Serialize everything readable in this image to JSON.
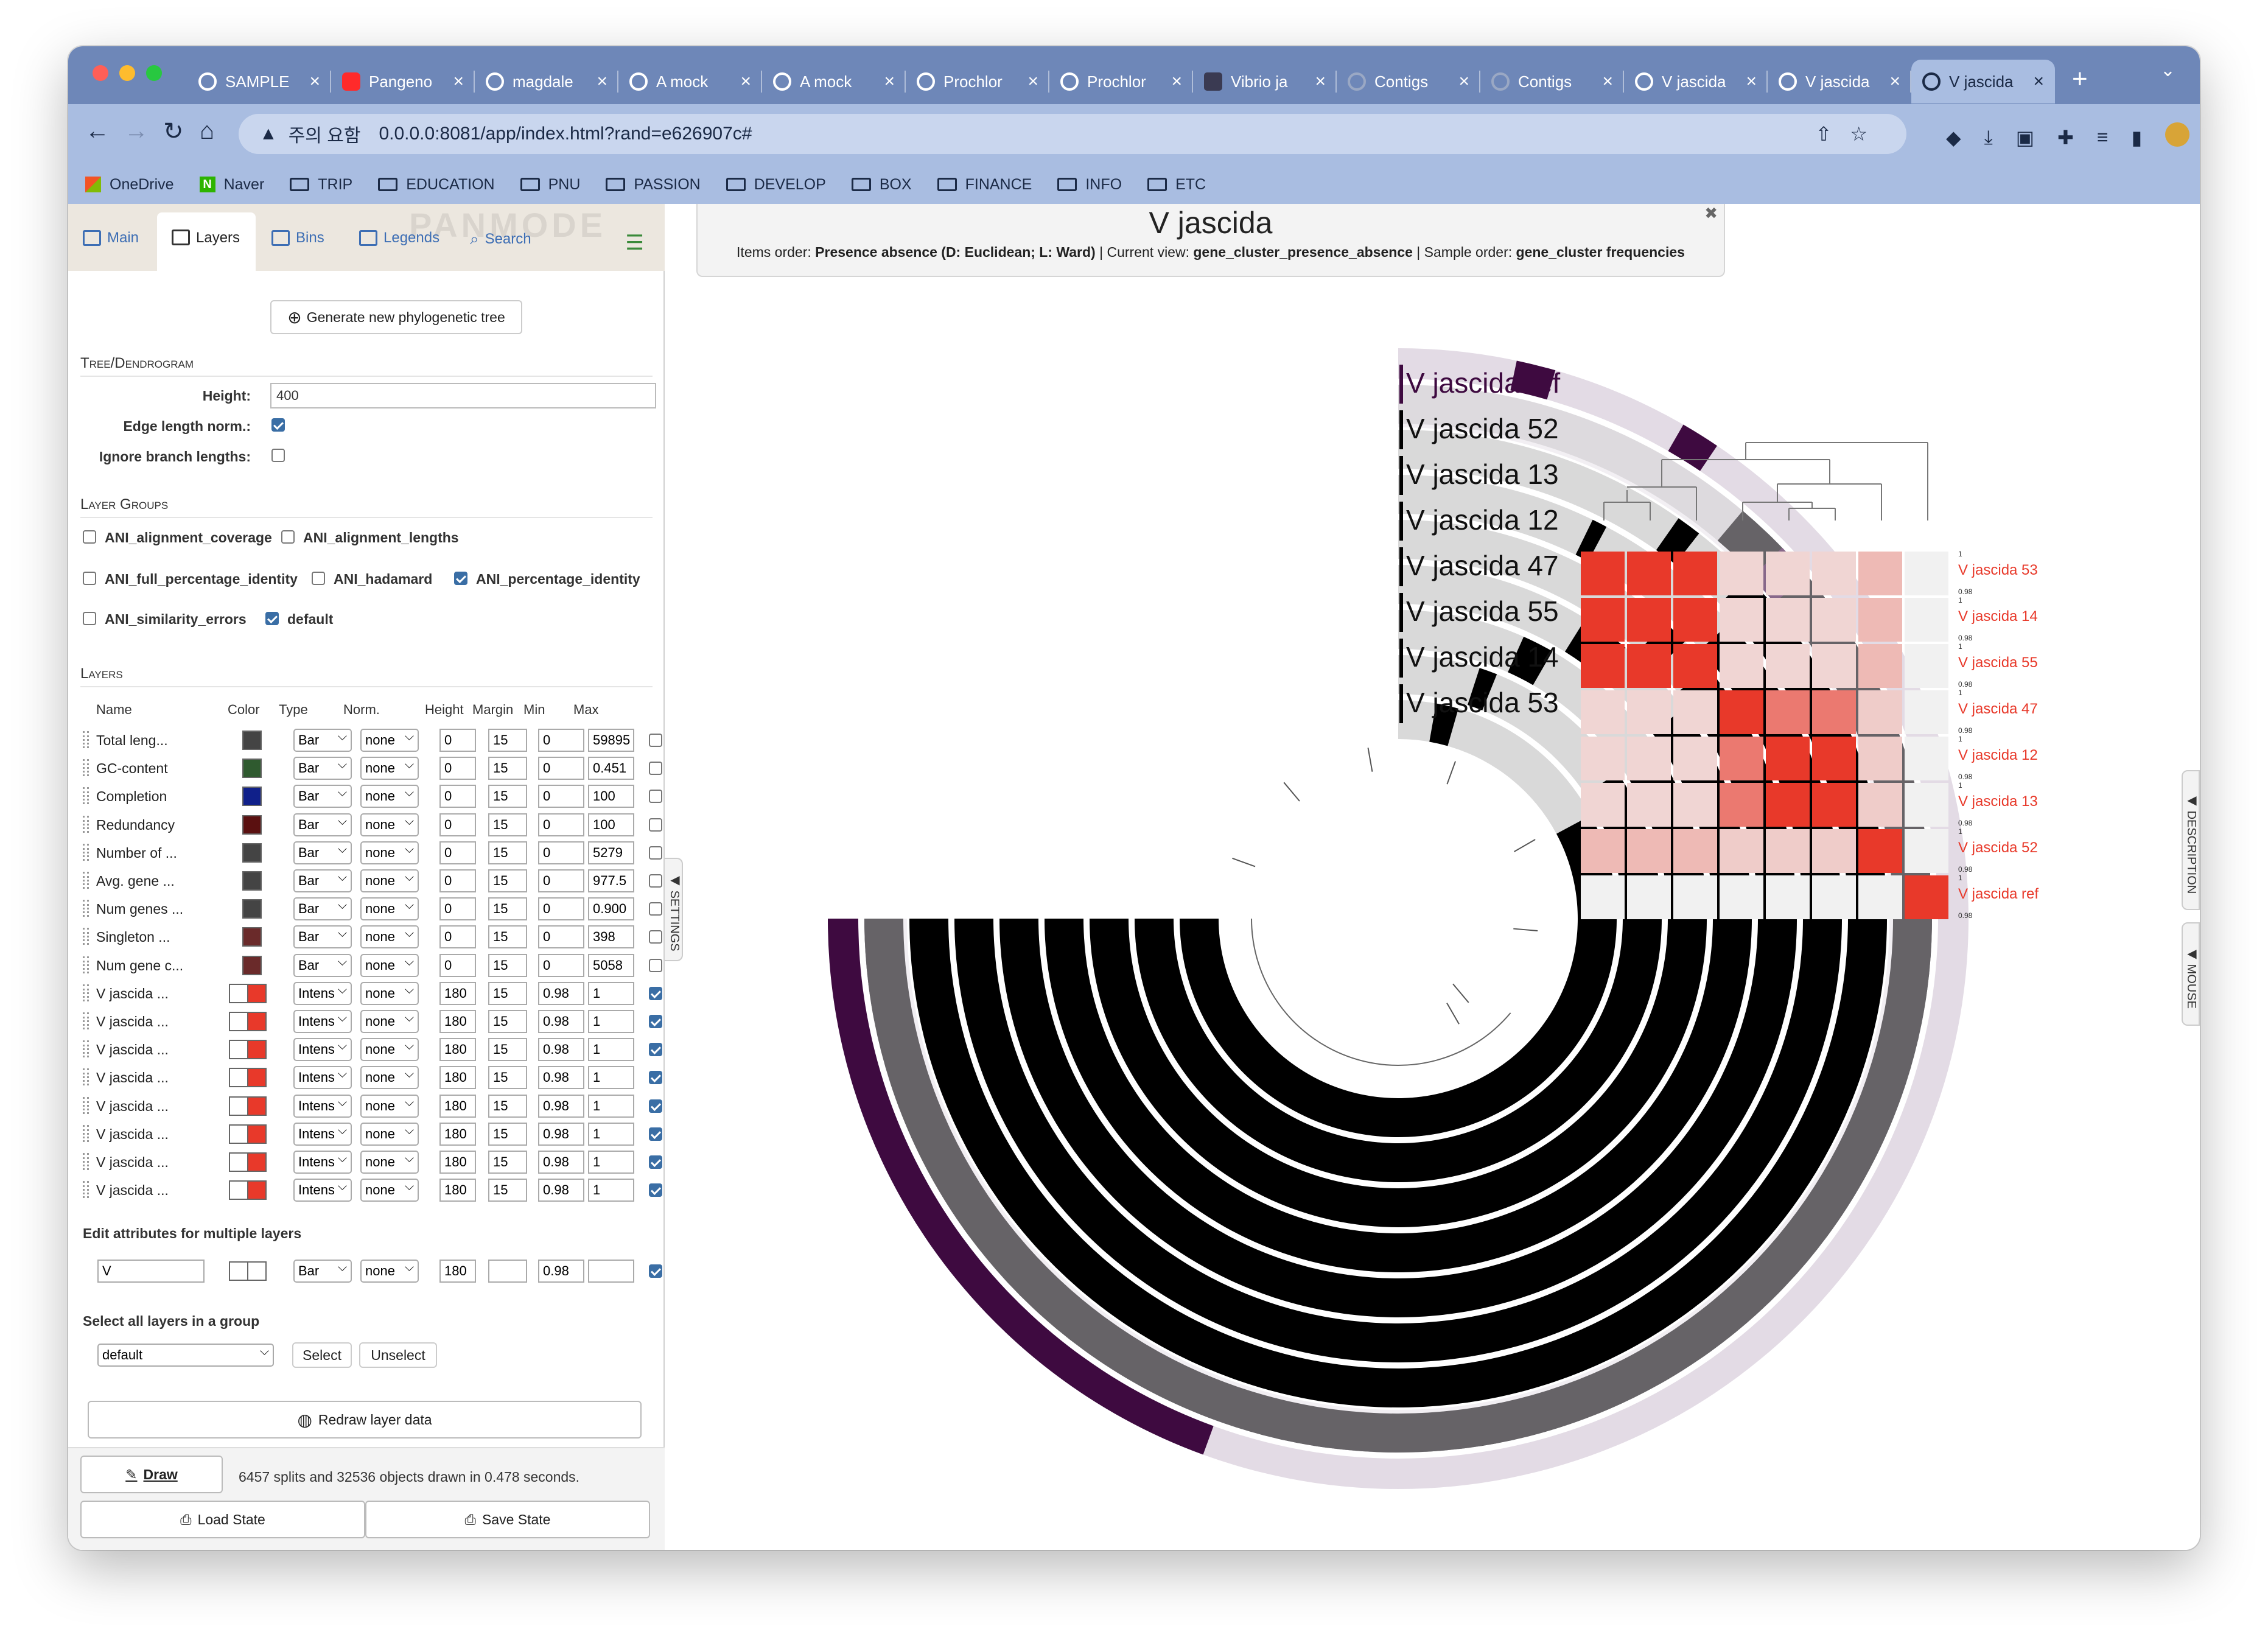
{
  "browser": {
    "tabs": [
      {
        "title": "SAMPLE",
        "icon": "github-icon",
        "variant": ""
      },
      {
        "title": "Pangeno",
        "icon": "youtube-icon",
        "variant": "yt"
      },
      {
        "title": "magdale",
        "icon": "github-icon",
        "variant": ""
      },
      {
        "title": "A mock",
        "icon": "github-icon",
        "variant": ""
      },
      {
        "title": "A mock",
        "icon": "github-icon",
        "variant": ""
      },
      {
        "title": "Prochlor",
        "icon": "github-icon",
        "variant": ""
      },
      {
        "title": "Prochlor",
        "icon": "github-icon",
        "variant": ""
      },
      {
        "title": "Vibrio ja",
        "icon": "page-icon",
        "variant": "dk"
      },
      {
        "title": "Contigs",
        "icon": "anvio-icon",
        "variant": "gr"
      },
      {
        "title": "Contigs",
        "icon": "anvio-icon",
        "variant": "gr"
      },
      {
        "title": "V jascida",
        "icon": "anvio-icon",
        "variant": ""
      },
      {
        "title": "V jascida",
        "icon": "anvio-icon",
        "variant": ""
      },
      {
        "title": "V jascida",
        "icon": "anvio-icon",
        "variant": "",
        "active": true
      }
    ],
    "address": {
      "warning": "주의 요함",
      "url": "0.0.0.0:8081/app/index.html?rand=e626907c#"
    },
    "bookmarks": [
      "OneDrive",
      "Naver",
      "TRIP",
      "EDUCATION",
      "PNU",
      "PASSION",
      "DEVELOP",
      "BOX",
      "FINANCE",
      "INFO",
      "ETC"
    ]
  },
  "sidebar": {
    "tabs": {
      "main": "Main",
      "layers": "Layers",
      "bins": "Bins",
      "legends": "Legends",
      "search": "Search"
    },
    "watermark": "PANMODE",
    "generate_tree_button": "Generate new phylogenetic tree",
    "tree_section": "Tree/Dendrogram",
    "height_label": "Height:",
    "height_value": "400",
    "edge_norm_label": "Edge length norm.:",
    "ignore_branch_label": "Ignore branch lengths:",
    "layer_groups_section": "Layer Groups",
    "layer_groups": [
      {
        "name": "ANI_alignment_coverage",
        "checked": false
      },
      {
        "name": "ANI_alignment_lengths",
        "checked": false
      },
      {
        "name": "ANI_full_percentage_identity",
        "checked": false
      },
      {
        "name": "ANI_hadamard",
        "checked": false
      },
      {
        "name": "ANI_percentage_identity",
        "checked": true
      },
      {
        "name": "ANI_similarity_errors",
        "checked": false
      },
      {
        "name": "default",
        "checked": true
      }
    ],
    "layers_section": "Layers",
    "columns": {
      "name": "Name",
      "color": "Color",
      "type": "Type",
      "norm": "Norm.",
      "height": "Height",
      "margin": "Margin",
      "min": "Min",
      "max": "Max"
    },
    "layers": [
      {
        "name": "Total leng...",
        "color": "#444444",
        "color2": "",
        "type": "Bar",
        "norm": "none",
        "height": "0",
        "margin": "15",
        "min": "0",
        "max": "59895",
        "checked": false
      },
      {
        "name": "GC-content",
        "color": "#2f5a2f",
        "color2": "",
        "type": "Bar",
        "norm": "none",
        "height": "0",
        "margin": "15",
        "min": "0",
        "max": "0.451",
        "checked": false
      },
      {
        "name": "Completion",
        "color": "#10208a",
        "color2": "",
        "type": "Bar",
        "norm": "none",
        "height": "0",
        "margin": "15",
        "min": "0",
        "max": "100",
        "checked": false
      },
      {
        "name": "Redundancy",
        "color": "#5a1010",
        "color2": "",
        "type": "Bar",
        "norm": "none",
        "height": "0",
        "margin": "15",
        "min": "0",
        "max": "100",
        "checked": false
      },
      {
        "name": "Number of ...",
        "color": "#444444",
        "color2": "",
        "type": "Bar",
        "norm": "none",
        "height": "0",
        "margin": "15",
        "min": "0",
        "max": "5279",
        "checked": false
      },
      {
        "name": "Avg. gene ...",
        "color": "#444444",
        "color2": "",
        "type": "Bar",
        "norm": "none",
        "height": "0",
        "margin": "15",
        "min": "0",
        "max": "977.5",
        "checked": false
      },
      {
        "name": "Num genes ...",
        "color": "#444444",
        "color2": "",
        "type": "Bar",
        "norm": "none",
        "height": "0",
        "margin": "15",
        "min": "0",
        "max": "0.900",
        "checked": false
      },
      {
        "name": "Singleton ...",
        "color": "#6a2a2a",
        "color2": "",
        "type": "Bar",
        "norm": "none",
        "height": "0",
        "margin": "15",
        "min": "0",
        "max": "398",
        "checked": false
      },
      {
        "name": "Num gene c...",
        "color": "#6a2a2a",
        "color2": "",
        "type": "Bar",
        "norm": "none",
        "height": "0",
        "margin": "15",
        "min": "0",
        "max": "5058",
        "checked": false
      },
      {
        "name": "V jascida ...",
        "color": "#ffffff",
        "color2": "#e8392a",
        "type": "Intens",
        "norm": "none",
        "height": "180",
        "margin": "15",
        "min": "0.98",
        "max": "1",
        "checked": true
      },
      {
        "name": "V jascida ...",
        "color": "#ffffff",
        "color2": "#e8392a",
        "type": "Intens",
        "norm": "none",
        "height": "180",
        "margin": "15",
        "min": "0.98",
        "max": "1",
        "checked": true
      },
      {
        "name": "V jascida ...",
        "color": "#ffffff",
        "color2": "#e8392a",
        "type": "Intens",
        "norm": "none",
        "height": "180",
        "margin": "15",
        "min": "0.98",
        "max": "1",
        "checked": true
      },
      {
        "name": "V jascida ...",
        "color": "#ffffff",
        "color2": "#e8392a",
        "type": "Intens",
        "norm": "none",
        "height": "180",
        "margin": "15",
        "min": "0.98",
        "max": "1",
        "checked": true
      },
      {
        "name": "V jascida ...",
        "color": "#ffffff",
        "color2": "#e8392a",
        "type": "Intens",
        "norm": "none",
        "height": "180",
        "margin": "15",
        "min": "0.98",
        "max": "1",
        "checked": true
      },
      {
        "name": "V jascida ...",
        "color": "#ffffff",
        "color2": "#e8392a",
        "type": "Intens",
        "norm": "none",
        "height": "180",
        "margin": "15",
        "min": "0.98",
        "max": "1",
        "checked": true
      },
      {
        "name": "V jascida ...",
        "color": "#ffffff",
        "color2": "#e8392a",
        "type": "Intens",
        "norm": "none",
        "height": "180",
        "margin": "15",
        "min": "0.98",
        "max": "1",
        "checked": true
      },
      {
        "name": "V jascida ...",
        "color": "#ffffff",
        "color2": "#e8392a",
        "type": "Intens",
        "norm": "none",
        "height": "180",
        "margin": "15",
        "min": "0.98",
        "max": "1",
        "checked": true
      }
    ],
    "edit_multi_label": "Edit attributes for multiple layers",
    "multi": {
      "filter": "V",
      "type": "Bar",
      "norm": "none",
      "height": "180",
      "margin": "",
      "min": "0.98",
      "max": "",
      "checked": true
    },
    "select_group_label": "Select all layers in a group",
    "group_select_value": "default",
    "select_button": "Select",
    "unselect_button": "Unselect",
    "redraw_button": "Redraw layer data",
    "draw_button": "Draw",
    "draw_status": "6457 splits and 32536 objects drawn in 0.478 seconds.",
    "load_state_button": "Load State",
    "save_state_button": "Save State"
  },
  "main": {
    "title": "V jascida",
    "subtitle": {
      "items_order_label": "Items order:",
      "items_order_value": "Presence absence (D: Euclidean; L: Ward)",
      "current_view_label": "Current view:",
      "current_view_value": "gene_cluster_presence_absence",
      "sample_order_label": "Sample order:",
      "sample_order_value": "gene_cluster frequencies"
    },
    "layer_labels": [
      "V jascida ref",
      "V jascida 52",
      "V jascida 13",
      "V jascida 12",
      "V jascida 47",
      "V jascida 55",
      "V jascida 14",
      "V jascida 53"
    ],
    "heatmap_row_labels": [
      "V jascida 53",
      "V jascida 14",
      "V jascida 55",
      "V jascida 47",
      "V jascida 12",
      "V jascida 13",
      "V jascida 52",
      "V jascida ref"
    ],
    "heatmap_scale_top": "1",
    "heatmap_scale_bottom": "0.98",
    "description_handle": "DESCRIPTION",
    "mouse_handle": "MOUSE",
    "settings_handle": "SETTINGS",
    "colors": {
      "ring_fill": "#000000",
      "ring_bg": "#d9d9d9",
      "accent_purple": "#3e0a40",
      "light_purple": "#e3dbe5",
      "heat_red": "#e8392a"
    }
  },
  "chart_data": {
    "type": "heatmap",
    "rows": [
      "V jascida 53",
      "V jascida 14",
      "V jascida 55",
      "V jascida 47",
      "V jascida 12",
      "V jascida 13",
      "V jascida 52",
      "V jascida ref"
    ],
    "columns": [
      "V jascida 53",
      "V jascida 14",
      "V jascida 55",
      "V jascida 47",
      "V jascida 12",
      "V jascida 13",
      "V jascida 52",
      "V jascida ref"
    ],
    "values": [
      [
        1,
        1,
        1,
        0.983,
        0.983,
        0.983,
        0.986,
        0.98
      ],
      [
        1,
        1,
        1,
        0.983,
        0.983,
        0.983,
        0.986,
        0.98
      ],
      [
        1,
        1,
        1,
        0.983,
        0.983,
        0.983,
        0.986,
        0.98
      ],
      [
        0.983,
        0.983,
        0.983,
        1,
        0.993,
        0.993,
        0.984,
        0.98
      ],
      [
        0.983,
        0.983,
        0.983,
        0.993,
        1,
        1,
        0.984,
        0.98
      ],
      [
        0.983,
        0.983,
        0.983,
        0.993,
        1,
        1,
        0.984,
        0.98
      ],
      [
        0.986,
        0.986,
        0.986,
        0.984,
        0.984,
        0.984,
        1,
        0.98
      ],
      [
        0.98,
        0.98,
        0.98,
        0.98,
        0.98,
        0.98,
        0.98,
        1
      ]
    ],
    "min": 0.98,
    "max": 1
  }
}
